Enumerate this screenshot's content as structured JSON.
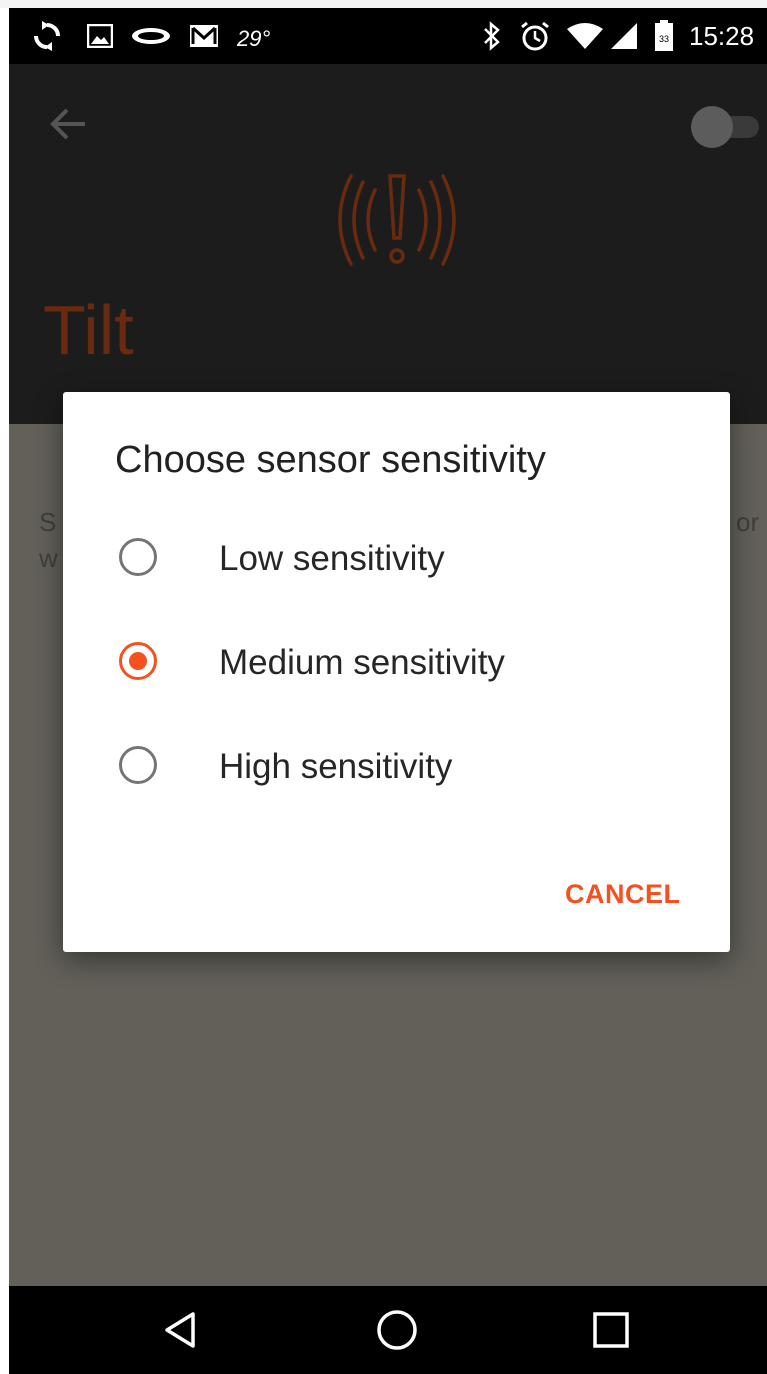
{
  "status_bar": {
    "temperature": "29°",
    "time": "15:28",
    "battery_level": "33",
    "icons": [
      "sync-icon",
      "gallery-icon",
      "carrier-logo-icon",
      "gmail-icon",
      "bluetooth-icon",
      "alarm-icon",
      "wifi-icon",
      "signal-icon",
      "battery-icon"
    ]
  },
  "app": {
    "title": "Tilt",
    "background_text_left": "S",
    "background_text_left_2": "w",
    "background_text_right": "or",
    "accent_color": "#f4511e",
    "title_color": "#6a2a10",
    "header_icon": "tilt-alarm-icon",
    "toggle_on": false
  },
  "dialog": {
    "title": "Choose sensor sensitivity",
    "options": [
      {
        "label": "Low sensitivity",
        "selected": false
      },
      {
        "label": "Medium sensitivity",
        "selected": true
      },
      {
        "label": "High sensitivity",
        "selected": false
      }
    ],
    "cancel_label": "CANCEL"
  },
  "nav_bar": {
    "buttons": [
      "back-icon",
      "home-icon",
      "recents-icon"
    ]
  }
}
